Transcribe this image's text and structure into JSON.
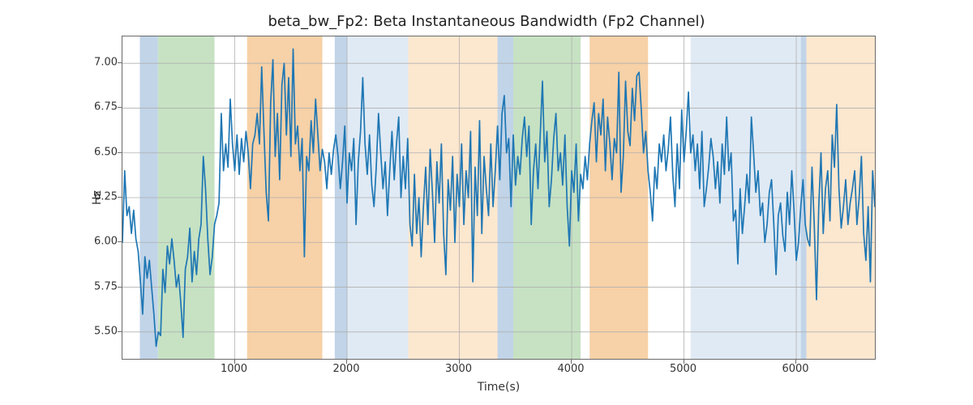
{
  "chart_data": {
    "type": "line",
    "title": "beta_bw_Fp2: Beta Instantaneous Bandwidth (Fp2 Channel)",
    "xlabel": "Time(s)",
    "ylabel": "Hz",
    "xlim": [
      0,
      6700
    ],
    "ylim": [
      5.35,
      7.15
    ],
    "xticks": [
      1000,
      2000,
      3000,
      4000,
      5000,
      6000
    ],
    "yticks": [
      5.5,
      5.75,
      6.0,
      6.25,
      6.5,
      6.75,
      7.0
    ],
    "grid": true,
    "line_color": "#1f77b4",
    "bands": [
      {
        "x0": 155,
        "x1": 316,
        "color": "#b6cde4"
      },
      {
        "x0": 316,
        "x1": 820,
        "color": "#bcddb8"
      },
      {
        "x0": 1110,
        "x1": 1780,
        "color": "#f6c998"
      },
      {
        "x0": 1890,
        "x1": 2000,
        "color": "#b6cde4"
      },
      {
        "x0": 2000,
        "x1": 2545,
        "color": "#dbe6f2"
      },
      {
        "x0": 2545,
        "x1": 3340,
        "color": "#fbe3c7"
      },
      {
        "x0": 3340,
        "x1": 3480,
        "color": "#b6cde4"
      },
      {
        "x0": 3480,
        "x1": 4080,
        "color": "#bcddb8"
      },
      {
        "x0": 4160,
        "x1": 4680,
        "color": "#f6c998"
      },
      {
        "x0": 5060,
        "x1": 6040,
        "color": "#dbe6f2"
      },
      {
        "x0": 6040,
        "x1": 6090,
        "color": "#b6cde4"
      },
      {
        "x0": 6090,
        "x1": 6700,
        "color": "#fbe3c7"
      }
    ],
    "x": [
      0,
      20,
      40,
      60,
      80,
      100,
      120,
      140,
      160,
      180,
      200,
      220,
      240,
      260,
      280,
      300,
      320,
      340,
      360,
      380,
      400,
      420,
      440,
      460,
      480,
      500,
      520,
      540,
      560,
      580,
      600,
      620,
      640,
      660,
      680,
      700,
      720,
      740,
      760,
      780,
      800,
      820,
      840,
      860,
      880,
      900,
      920,
      940,
      960,
      980,
      1000,
      1020,
      1040,
      1060,
      1080,
      1100,
      1120,
      1140,
      1160,
      1180,
      1200,
      1220,
      1240,
      1260,
      1280,
      1300,
      1320,
      1340,
      1360,
      1380,
      1400,
      1420,
      1440,
      1460,
      1480,
      1500,
      1520,
      1540,
      1560,
      1580,
      1600,
      1620,
      1640,
      1660,
      1680,
      1700,
      1720,
      1740,
      1760,
      1780,
      1800,
      1820,
      1840,
      1860,
      1880,
      1900,
      1920,
      1940,
      1960,
      1980,
      2000,
      2020,
      2040,
      2060,
      2080,
      2100,
      2120,
      2140,
      2160,
      2180,
      2200,
      2220,
      2240,
      2260,
      2280,
      2300,
      2320,
      2340,
      2360,
      2380,
      2400,
      2420,
      2440,
      2460,
      2480,
      2500,
      2520,
      2540,
      2560,
      2580,
      2600,
      2620,
      2640,
      2660,
      2680,
      2700,
      2720,
      2740,
      2760,
      2780,
      2800,
      2820,
      2840,
      2860,
      2880,
      2900,
      2920,
      2940,
      2960,
      2980,
      3000,
      3020,
      3040,
      3060,
      3080,
      3100,
      3120,
      3140,
      3160,
      3180,
      3200,
      3220,
      3240,
      3260,
      3280,
      3300,
      3320,
      3340,
      3360,
      3380,
      3400,
      3420,
      3440,
      3460,
      3480,
      3500,
      3520,
      3540,
      3560,
      3580,
      3600,
      3620,
      3640,
      3660,
      3680,
      3700,
      3720,
      3740,
      3760,
      3780,
      3800,
      3820,
      3840,
      3860,
      3880,
      3900,
      3920,
      3940,
      3960,
      3980,
      4000,
      4020,
      4040,
      4060,
      4080,
      4100,
      4120,
      4140,
      4160,
      4180,
      4200,
      4220,
      4240,
      4260,
      4280,
      4300,
      4320,
      4340,
      4360,
      4380,
      4400,
      4420,
      4440,
      4460,
      4480,
      4500,
      4520,
      4540,
      4560,
      4580,
      4600,
      4620,
      4640,
      4660,
      4680,
      4700,
      4720,
      4740,
      4760,
      4780,
      4800,
      4820,
      4840,
      4860,
      4880,
      4900,
      4920,
      4940,
      4960,
      4980,
      5000,
      5020,
      5040,
      5060,
      5080,
      5100,
      5120,
      5140,
      5160,
      5180,
      5200,
      5220,
      5240,
      5260,
      5280,
      5300,
      5320,
      5340,
      5360,
      5380,
      5400,
      5420,
      5440,
      5460,
      5480,
      5500,
      5520,
      5540,
      5560,
      5580,
      5600,
      5620,
      5640,
      5660,
      5680,
      5700,
      5720,
      5740,
      5760,
      5780,
      5800,
      5820,
      5840,
      5860,
      5880,
      5900,
      5920,
      5940,
      5960,
      5980,
      6000,
      6020,
      6040,
      6060,
      6080,
      6100,
      6120,
      6140,
      6160,
      6180,
      6200,
      6220,
      6240,
      6260,
      6280,
      6300,
      6320,
      6340,
      6360,
      6380,
      6400,
      6420,
      6440,
      6460,
      6480,
      6500,
      6520,
      6540,
      6560,
      6580,
      6600,
      6620,
      6640,
      6660,
      6680,
      6700
    ],
    "values": [
      6.0,
      6.4,
      6.15,
      6.2,
      6.05,
      6.18,
      6.02,
      5.95,
      5.78,
      5.6,
      5.92,
      5.8,
      5.9,
      5.75,
      5.6,
      5.42,
      5.5,
      5.48,
      5.85,
      5.72,
      5.98,
      5.88,
      6.02,
      5.9,
      5.75,
      5.82,
      5.66,
      5.47,
      5.85,
      5.92,
      6.08,
      5.78,
      5.95,
      5.82,
      6.02,
      6.1,
      6.48,
      6.3,
      6.02,
      5.82,
      5.92,
      6.1,
      6.15,
      6.22,
      6.72,
      6.4,
      6.55,
      6.42,
      6.8,
      6.55,
      6.4,
      6.6,
      6.38,
      6.58,
      6.45,
      6.62,
      6.5,
      6.3,
      6.55,
      6.6,
      6.72,
      6.55,
      6.98,
      6.62,
      6.28,
      6.12,
      6.78,
      7.02,
      6.48,
      6.72,
      6.35,
      6.88,
      7.0,
      6.6,
      6.92,
      6.48,
      7.08,
      6.55,
      6.65,
      6.4,
      6.58,
      5.92,
      6.48,
      6.4,
      6.68,
      6.5,
      6.8,
      6.6,
      6.4,
      6.52,
      6.45,
      6.3,
      6.5,
      6.38,
      6.52,
      6.6,
      6.48,
      6.3,
      6.45,
      6.65,
      6.22,
      6.5,
      6.4,
      6.58,
      6.1,
      6.45,
      6.62,
      6.92,
      6.55,
      6.38,
      6.6,
      6.32,
      6.2,
      6.42,
      6.72,
      6.5,
      6.3,
      6.45,
      6.15,
      6.4,
      6.62,
      6.35,
      6.55,
      6.7,
      6.25,
      6.48,
      6.3,
      6.58,
      6.1,
      5.98,
      6.38,
      6.05,
      6.25,
      5.92,
      6.2,
      6.42,
      6.1,
      6.52,
      6.28,
      6.0,
      6.45,
      6.22,
      6.55,
      6.05,
      5.82,
      6.35,
      6.18,
      6.48,
      6.0,
      6.38,
      6.2,
      6.55,
      6.1,
      6.4,
      6.25,
      6.62,
      5.78,
      6.42,
      6.15,
      6.68,
      6.05,
      6.48,
      6.3,
      6.15,
      6.55,
      6.2,
      6.4,
      6.65,
      6.35,
      6.72,
      6.82,
      6.5,
      6.58,
      6.2,
      6.6,
      6.32,
      6.48,
      6.38,
      6.58,
      6.7,
      6.48,
      6.65,
      6.1,
      6.4,
      6.55,
      6.3,
      6.6,
      6.9,
      6.45,
      6.62,
      6.2,
      6.35,
      6.58,
      6.72,
      6.4,
      6.5,
      6.32,
      6.6,
      6.2,
      5.98,
      6.4,
      6.28,
      6.55,
      6.12,
      6.38,
      6.3,
      6.48,
      6.35,
      6.55,
      6.68,
      6.78,
      6.45,
      6.72,
      6.6,
      6.8,
      6.4,
      6.7,
      6.55,
      6.35,
      6.58,
      6.5,
      6.95,
      6.28,
      6.48,
      6.9,
      6.62,
      6.54,
      6.86,
      6.68,
      6.93,
      6.95,
      6.74,
      6.5,
      6.62,
      6.4,
      6.28,
      6.12,
      6.42,
      6.3,
      6.55,
      6.45,
      6.6,
      6.4,
      6.52,
      6.7,
      6.38,
      6.2,
      6.55,
      6.3,
      6.74,
      6.45,
      6.62,
      6.84,
      6.5,
      6.6,
      6.4,
      6.55,
      6.3,
      6.62,
      6.2,
      6.3,
      6.42,
      6.58,
      6.48,
      6.3,
      6.45,
      6.22,
      6.55,
      6.38,
      6.7,
      6.4,
      6.5,
      6.12,
      6.18,
      5.88,
      6.3,
      6.05,
      6.2,
      6.38,
      6.22,
      6.7,
      6.5,
      6.28,
      6.4,
      6.15,
      6.22,
      6.0,
      6.1,
      6.28,
      6.35,
      6.1,
      5.82,
      6.15,
      6.22,
      6.04,
      5.95,
      6.28,
      6.1,
      6.4,
      6.18,
      5.9,
      6.0,
      6.2,
      6.35,
      6.1,
      6.02,
      5.98,
      6.42,
      6.1,
      5.68,
      6.2,
      6.5,
      6.05,
      6.3,
      6.4,
      6.12,
      6.6,
      6.42,
      6.77,
      6.3,
      6.08,
      6.2,
      6.35,
      6.1,
      6.22,
      6.3,
      6.4,
      6.1,
      6.25,
      6.48,
      6.05,
      5.9,
      6.2,
      5.78,
      6.4,
      6.2,
      6.34
    ]
  }
}
